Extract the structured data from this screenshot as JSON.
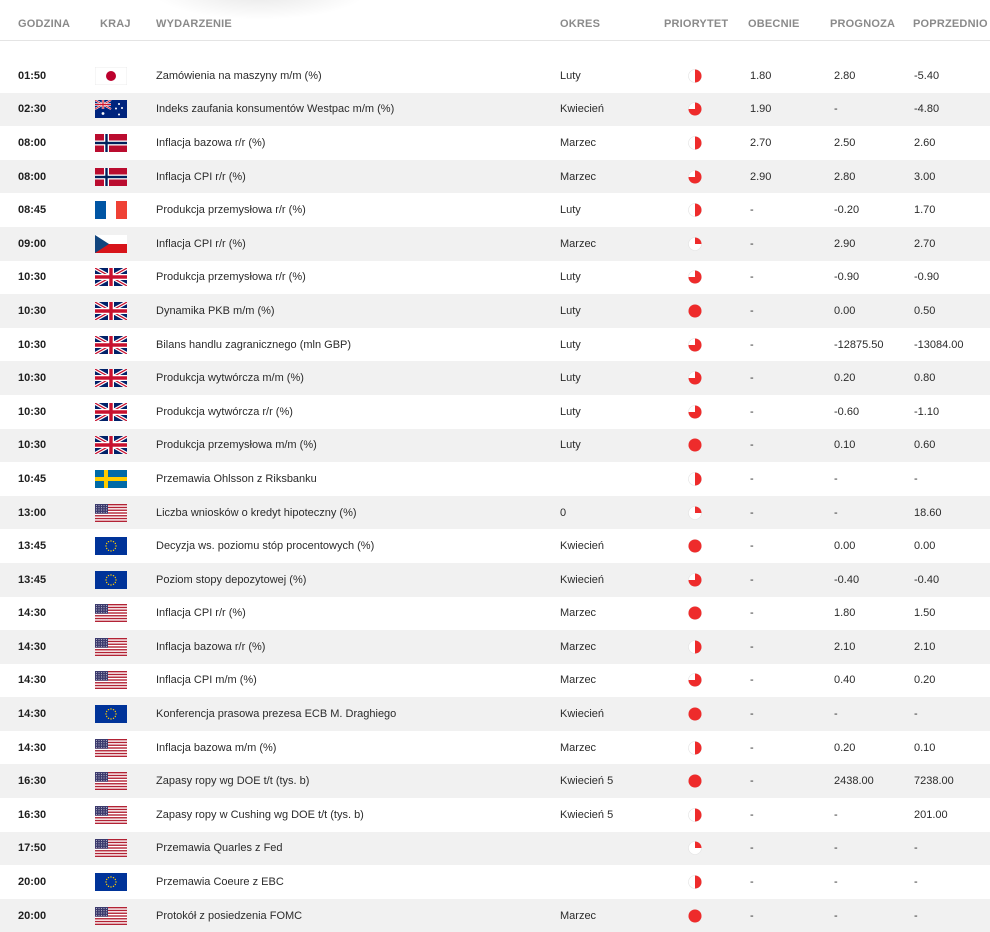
{
  "columns": {
    "time": "GODZINA",
    "country": "KRAJ",
    "event": "WYDARZENIE",
    "period": "OKRES",
    "priority": "PRIORYTET",
    "actual": "OBECNIE",
    "forecast": "PROGNOZA",
    "previous": "POPRZEDNIO"
  },
  "colors": {
    "priority": "#ee2b2b",
    "alt_row": "#f1f1f1"
  },
  "events": [
    {
      "time": "01:50",
      "country": "jp",
      "event": "Zamówienia na maszyny m/m (%)",
      "period": "Luty",
      "priority": "medium",
      "actual": "1.80",
      "forecast": "2.80",
      "previous": "-5.40"
    },
    {
      "time": "02:30",
      "country": "au",
      "event": "Indeks zaufania konsumentów Westpac m/m (%)",
      "period": "Kwiecień",
      "priority": "high",
      "actual": "1.90",
      "forecast": "-",
      "previous": "-4.80"
    },
    {
      "time": "08:00",
      "country": "no",
      "event": "Inflacja bazowa r/r (%)",
      "period": "Marzec",
      "priority": "medium",
      "actual": "2.70",
      "forecast": "2.50",
      "previous": "2.60"
    },
    {
      "time": "08:00",
      "country": "no",
      "event": "Inflacja CPI r/r (%)",
      "period": "Marzec",
      "priority": "high",
      "actual": "2.90",
      "forecast": "2.80",
      "previous": "3.00"
    },
    {
      "time": "08:45",
      "country": "fr",
      "event": "Produkcja przemysłowa r/r (%)",
      "period": "Luty",
      "priority": "medium",
      "actual": "-",
      "forecast": "-0.20",
      "previous": "1.70"
    },
    {
      "time": "09:00",
      "country": "cz",
      "event": "Inflacja CPI r/r (%)",
      "period": "Marzec",
      "priority": "low",
      "actual": "-",
      "forecast": "2.90",
      "previous": "2.70"
    },
    {
      "time": "10:30",
      "country": "gb",
      "event": "Produkcja przemysłowa r/r (%)",
      "period": "Luty",
      "priority": "high",
      "actual": "-",
      "forecast": "-0.90",
      "previous": "-0.90"
    },
    {
      "time": "10:30",
      "country": "gb",
      "event": "Dynamika PKB m/m (%)",
      "period": "Luty",
      "priority": "full",
      "actual": "-",
      "forecast": "0.00",
      "previous": "0.50"
    },
    {
      "time": "10:30",
      "country": "gb",
      "event": "Bilans handlu zagranicznego (mln GBP)",
      "period": "Luty",
      "priority": "high",
      "actual": "-",
      "forecast": "-12875.50",
      "previous": "-13084.00"
    },
    {
      "time": "10:30",
      "country": "gb",
      "event": "Produkcja wytwórcza m/m (%)",
      "period": "Luty",
      "priority": "high",
      "actual": "-",
      "forecast": "0.20",
      "previous": "0.80"
    },
    {
      "time": "10:30",
      "country": "gb",
      "event": "Produkcja wytwórcza r/r (%)",
      "period": "Luty",
      "priority": "high",
      "actual": "-",
      "forecast": "-0.60",
      "previous": "-1.10"
    },
    {
      "time": "10:30",
      "country": "gb",
      "event": "Produkcja przemysłowa m/m (%)",
      "period": "Luty",
      "priority": "full",
      "actual": "-",
      "forecast": "0.10",
      "previous": "0.60"
    },
    {
      "time": "10:45",
      "country": "se",
      "event": "Przemawia Ohlsson z Riksbanku",
      "period": "",
      "priority": "medium",
      "actual": "-",
      "forecast": "-",
      "previous": "-"
    },
    {
      "time": "13:00",
      "country": "us",
      "event": "Liczba wniosków o kredyt hipoteczny (%)",
      "period": "0",
      "priority": "low",
      "actual": "-",
      "forecast": "-",
      "previous": "18.60"
    },
    {
      "time": "13:45",
      "country": "eu",
      "event": "Decyzja ws. poziomu stóp procentowych (%)",
      "period": "Kwiecień",
      "priority": "full",
      "actual": "-",
      "forecast": "0.00",
      "previous": "0.00"
    },
    {
      "time": "13:45",
      "country": "eu",
      "event": "Poziom stopy depozytowej (%)",
      "period": "Kwiecień",
      "priority": "high",
      "actual": "-",
      "forecast": "-0.40",
      "previous": "-0.40"
    },
    {
      "time": "14:30",
      "country": "us",
      "event": "Inflacja CPI r/r (%)",
      "period": "Marzec",
      "priority": "full",
      "actual": "-",
      "forecast": "1.80",
      "previous": "1.50"
    },
    {
      "time": "14:30",
      "country": "us",
      "event": "Inflacja bazowa r/r (%)",
      "period": "Marzec",
      "priority": "medium",
      "actual": "-",
      "forecast": "2.10",
      "previous": "2.10"
    },
    {
      "time": "14:30",
      "country": "us",
      "event": "Inflacja CPI m/m (%)",
      "period": "Marzec",
      "priority": "high",
      "actual": "-",
      "forecast": "0.40",
      "previous": "0.20"
    },
    {
      "time": "14:30",
      "country": "eu",
      "event": "Konferencja prasowa prezesa ECB M. Draghiego",
      "period": "Kwiecień",
      "priority": "full",
      "actual": "-",
      "forecast": "-",
      "previous": "-"
    },
    {
      "time": "14:30",
      "country": "us",
      "event": "Inflacja bazowa m/m (%)",
      "period": "Marzec",
      "priority": "medium",
      "actual": "-",
      "forecast": "0.20",
      "previous": "0.10"
    },
    {
      "time": "16:30",
      "country": "us",
      "event": "Zapasy ropy wg DOE t/t (tys. b)",
      "period": "Kwiecień 5",
      "priority": "full",
      "actual": "-",
      "forecast": "2438.00",
      "previous": "7238.00"
    },
    {
      "time": "16:30",
      "country": "us",
      "event": "Zapasy ropy w Cushing wg DOE t/t (tys. b)",
      "period": "Kwiecień 5",
      "priority": "medium",
      "actual": "-",
      "forecast": "-",
      "previous": "201.00"
    },
    {
      "time": "17:50",
      "country": "us",
      "event": "Przemawia Quarles z Fed",
      "period": "",
      "priority": "low",
      "actual": "-",
      "forecast": "-",
      "previous": "-"
    },
    {
      "time": "20:00",
      "country": "eu",
      "event": "Przemawia Coeure z EBC",
      "period": "",
      "priority": "medium",
      "actual": "-",
      "forecast": "-",
      "previous": "-"
    },
    {
      "time": "20:00",
      "country": "us",
      "event": "Protokół z posiedzenia FOMC",
      "period": "Marzec",
      "priority": "full",
      "actual": "-",
      "forecast": "-",
      "previous": "-"
    }
  ]
}
